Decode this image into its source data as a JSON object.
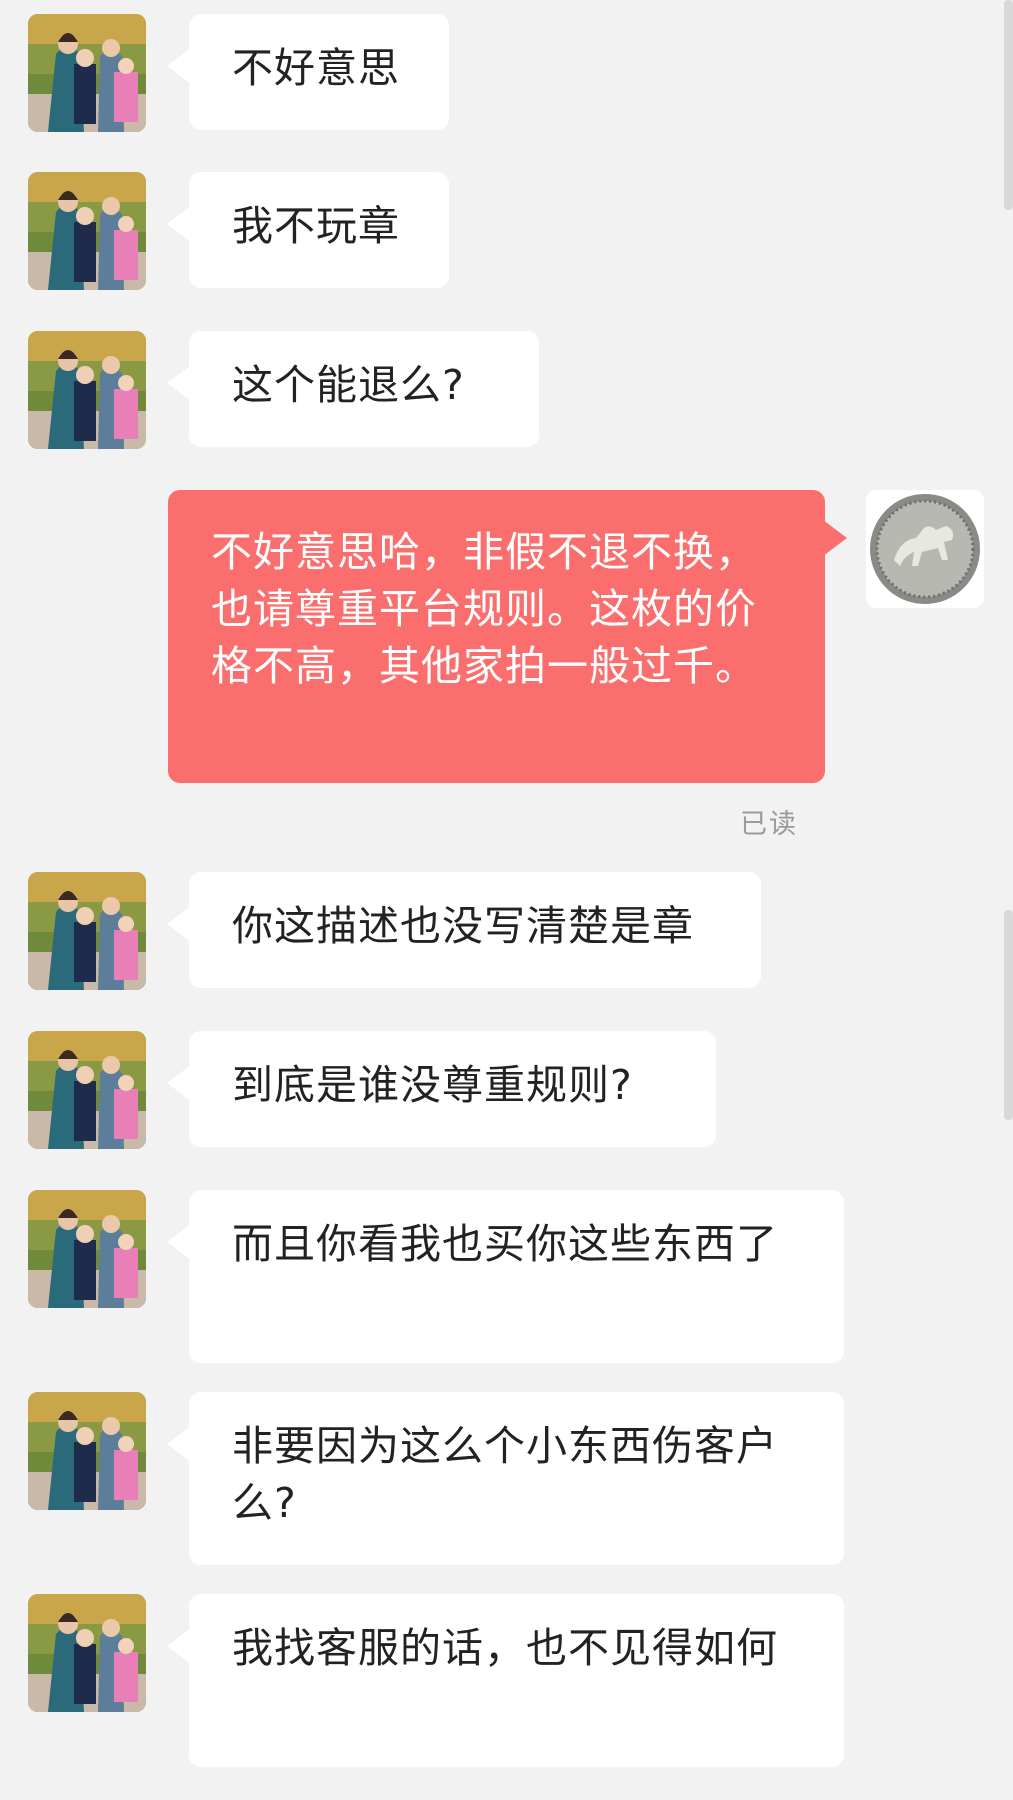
{
  "messages": [
    {
      "sender": "other",
      "text": "不好意思"
    },
    {
      "sender": "other",
      "text": "我不玩章"
    },
    {
      "sender": "other",
      "text": "这个能退么?"
    },
    {
      "sender": "self",
      "text": "不好意思哈，非假不退不换，也请尊重平台规则。这枚的价格不高，其他家拍一般过千。",
      "status": "已读"
    },
    {
      "sender": "other",
      "text": "你这描述也没写清楚是章"
    },
    {
      "sender": "other",
      "text": "到底是谁没尊重规则?"
    },
    {
      "sender": "other",
      "text": "而且你看我也买你这些东西了"
    },
    {
      "sender": "other",
      "text": "非要因为这么个小东西伤客户么?"
    },
    {
      "sender": "other",
      "text": "我找客服的话，也不见得如何"
    }
  ],
  "icons": {
    "other_avatar": "family-photo-avatar",
    "self_avatar": "silver-horse-coin-avatar"
  },
  "colors": {
    "background": "#f2f2f2",
    "incoming_bubble": "#ffffff",
    "outgoing_bubble": "#fa6e6d",
    "read_status": "#9a9a9a"
  }
}
